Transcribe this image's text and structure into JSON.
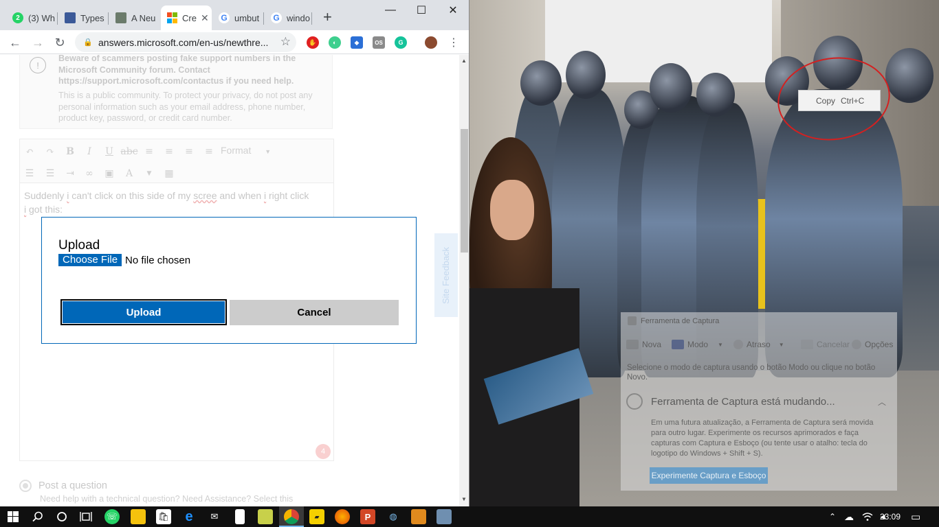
{
  "tabs": [
    {
      "label": "(3) Wh",
      "badge": "2",
      "color": "#25d366"
    },
    {
      "label": "Types",
      "color": "#3b5998"
    },
    {
      "label": "A Neu",
      "color": "#7a8a7a"
    },
    {
      "label": "Cre",
      "active": true,
      "color": "#f25022"
    },
    {
      "label": "umbut",
      "color": "#4285f4"
    },
    {
      "label": "windo",
      "color": "#4285f4"
    }
  ],
  "window_controls": {
    "minimize": "—",
    "maximize": "☐",
    "close": "✕"
  },
  "toolbar": {
    "url": "answers.microsoft.com/en-us/newthre...",
    "icons": [
      "back-icon",
      "forward-icon",
      "reload-icon",
      "lock-icon",
      "star-icon",
      "menu-icon"
    ]
  },
  "notice": {
    "line1": "Beware of scammers posting fake support numbers in the Microsoft Community forum. Contact https://support.microsoft.com/contactus if you need help.",
    "line2": "This is a public community. To protect your privacy, do not post any personal information such as your email address, phone number, product key, password, or credit card number."
  },
  "editor": {
    "format_label": "Format",
    "text_before": "Suddenly ",
    "text_i1": "i",
    "text_mid": " can't click on this side of my ",
    "text_scree": "scree",
    "text_mid2": " and when ",
    "text_i2": "i",
    "text_end": " right click",
    "text_line2_a": "i",
    "text_line2_b": " got this:",
    "counter": "4"
  },
  "post": {
    "label": "Post a question",
    "sub": "Need help with a technical question? Need Assistance? Select this"
  },
  "feedback_label": "Site Feedback",
  "dialog": {
    "title": "Upload",
    "choose_label": "Choose File",
    "no_file": "No file chosen",
    "upload_label": "Upload",
    "cancel_label": "Cancel"
  },
  "context_menu": {
    "copy": "Copy",
    "shortcut": "Ctrl+C"
  },
  "snipping": {
    "title": "Ferramenta de Captura",
    "new": "Nova",
    "mode": "Modo",
    "delay": "Atraso",
    "cancel": "Cancelar",
    "options": "Opções",
    "desc": "Selecione o modo de captura usando o botão Modo ou clique no botão Novo.",
    "header": "Ferramenta de Captura está mudando...",
    "body": "Em uma futura atualização, a Ferramenta de Captura será movida para outro lugar. Experimente os recursos aprimorados e faça capturas com Captura e Esboço (ou tente usar o atalho: tecla do logotipo do Windows + Shift + S).",
    "try_label": "Experimente Captura e Esboço"
  },
  "taskbar": {
    "clock": "23:09"
  }
}
